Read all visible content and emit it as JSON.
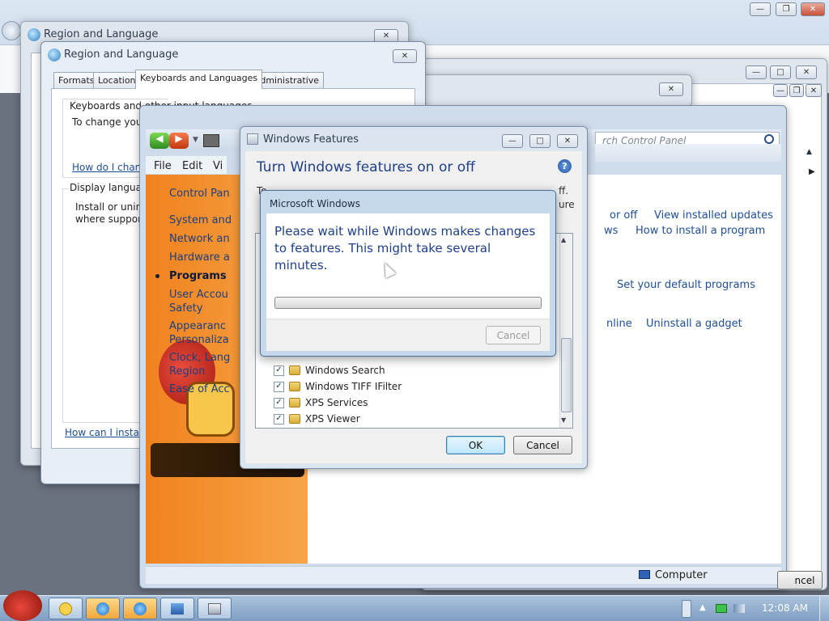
{
  "colors": {
    "accent": "#1e4e99",
    "orange_panel": "#f0821e",
    "progress_green": "#4caf50"
  },
  "top_window": {
    "controls": [
      "minimize-icon",
      "restore-icon",
      "close-icon"
    ]
  },
  "region_back": {
    "title": "Region and Language"
  },
  "region_front": {
    "title": "Region and Language",
    "tabs": [
      "Formats",
      "Location",
      "Keyboards and Languages",
      "Administrative"
    ],
    "keyboards_heading": "Keyboards and other input languages",
    "keyboards_text": "To change your",
    "keyboards_link": "How do I chang",
    "display_heading": "Display language",
    "display_text_1": "Install or uninst",
    "display_text_2": "where supporte",
    "install_link": "How can I install a"
  },
  "control_panel": {
    "menu": [
      "File",
      "Edit",
      "Vi"
    ],
    "sidebar": [
      "Control Pan",
      "System and",
      "Network an",
      "Hardware a",
      "Programs",
      "User Accou",
      "Safety",
      "Appearanc",
      "Personaliza",
      "Clock, Lang",
      "Region",
      "Ease of Acc"
    ],
    "search_placeholder": "rch Control Panel",
    "links": {
      "on_off": "or off",
      "view_updates": "View installed updates",
      "ws": "ws",
      "install_program": "How to install a program",
      "default_programs": "Set your default programs",
      "nline": "nline",
      "uninstall_gadget": "Uninstall a gadget"
    },
    "status": "Computer",
    "cancel_partial": "ncel"
  },
  "windows_features": {
    "title": "Windows Features",
    "heading": "Turn Windows features on or off",
    "desc_left": "To",
    "desc_right": "ff.",
    "desc_right2": "ure",
    "items": [
      "Windows Search",
      "Windows TIFF IFilter",
      "XPS Services",
      "XPS Viewer"
    ],
    "ok": "OK",
    "cancel": "Cancel"
  },
  "progress_dialog": {
    "title": "Microsoft Windows",
    "message": "Please wait while Windows makes changes to features. This might take several minutes.",
    "cancel": "Cancel",
    "progress": 0.0
  },
  "taskbar": {
    "clock": "12:08 AM",
    "buttons": [
      "smiley-icon",
      "ie-icon",
      "ie-icon",
      "control-panel-icon",
      "features-icon"
    ]
  }
}
